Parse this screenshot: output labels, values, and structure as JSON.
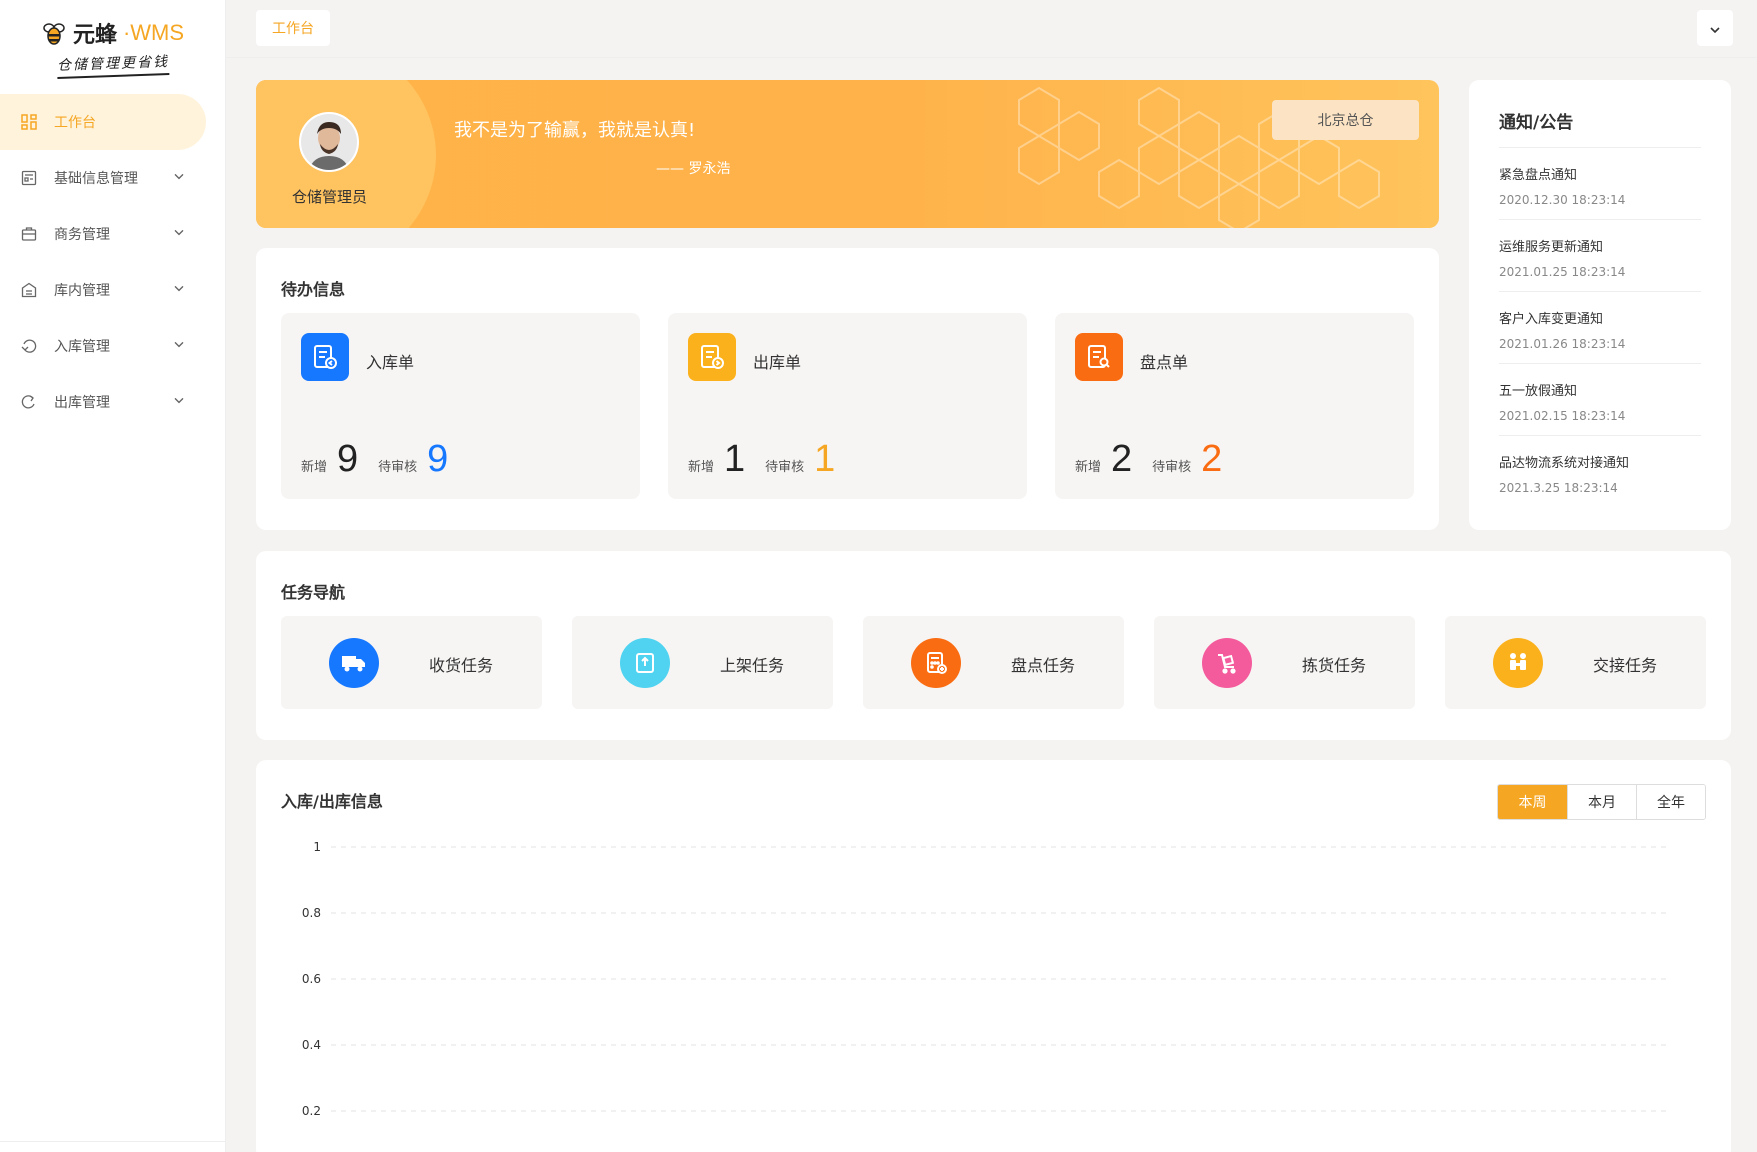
{
  "brand": {
    "name_cn": "元蜂",
    "name_en": "·WMS",
    "slogan": "仓储管理更省钱"
  },
  "sidebar": {
    "items": [
      {
        "label": "工作台",
        "icon": "dashboard-icon",
        "active": true,
        "expandable": false
      },
      {
        "label": "基础信息管理",
        "icon": "info-icon",
        "active": false,
        "expandable": true
      },
      {
        "label": "商务管理",
        "icon": "briefcase-icon",
        "active": false,
        "expandable": true
      },
      {
        "label": "库内管理",
        "icon": "warehouse-icon",
        "active": false,
        "expandable": true
      },
      {
        "label": "入库管理",
        "icon": "inbound-icon",
        "active": false,
        "expandable": true
      },
      {
        "label": "出库管理",
        "icon": "outbound-icon",
        "active": false,
        "expandable": true
      }
    ]
  },
  "topbar": {
    "tab": "工作台"
  },
  "banner": {
    "role": "仓储管理员",
    "motto": "我不是为了输赢，我就是认真!",
    "author": "—— 罗永浩",
    "warehouse": "北京总仓"
  },
  "notice": {
    "title": "通知/公告",
    "items": [
      {
        "title": "紧急盘点通知",
        "time": "2020.12.30 18:23:14"
      },
      {
        "title": "运维服务更新通知",
        "time": "2021.01.25 18:23:14"
      },
      {
        "title": "客户入库变更通知",
        "time": "2021.01.26 18:23:14"
      },
      {
        "title": "五一放假通知",
        "time": "2021.02.15 18:23:14"
      },
      {
        "title": "品达物流系统对接通知",
        "time": "2021.3.25 18:23:14"
      }
    ]
  },
  "todo": {
    "title": "待办信息",
    "new_label": "新增",
    "pending_label": "待审核",
    "cards": [
      {
        "name": "入库单",
        "new": "9",
        "pending": "9",
        "color": "#1677ff",
        "pending_color": "#1677ff"
      },
      {
        "name": "出库单",
        "new": "1",
        "pending": "1",
        "color": "#fbb11c",
        "pending_color": "#f5a623"
      },
      {
        "name": "盘点单",
        "new": "2",
        "pending": "2",
        "color": "#fa6c12",
        "pending_color": "#fa6c12"
      }
    ]
  },
  "tasks": {
    "title": "任务导航",
    "items": [
      {
        "label": "收货任务",
        "color": "#1677ff",
        "icon": "truck-icon"
      },
      {
        "label": "上架任务",
        "color": "#4fd3f0",
        "icon": "shelf-icon"
      },
      {
        "label": "盘点任务",
        "color": "#fa6c12",
        "icon": "calculator-icon"
      },
      {
        "label": "拣货任务",
        "color": "#f45b9c",
        "icon": "cart-icon"
      },
      {
        "label": "交接任务",
        "color": "#fbb11c",
        "icon": "handover-icon"
      }
    ]
  },
  "io": {
    "title": "入库/出库信息",
    "ranges": [
      "本周",
      "本月",
      "全年"
    ],
    "selected": "本周"
  },
  "colors": {
    "accent": "#f5a623"
  },
  "chart_data": {
    "type": "line",
    "yticks": [
      "1",
      "0.8",
      "0.6",
      "0.4",
      "0.2"
    ],
    "ylim": [
      0,
      1
    ],
    "grid": true,
    "series": []
  }
}
